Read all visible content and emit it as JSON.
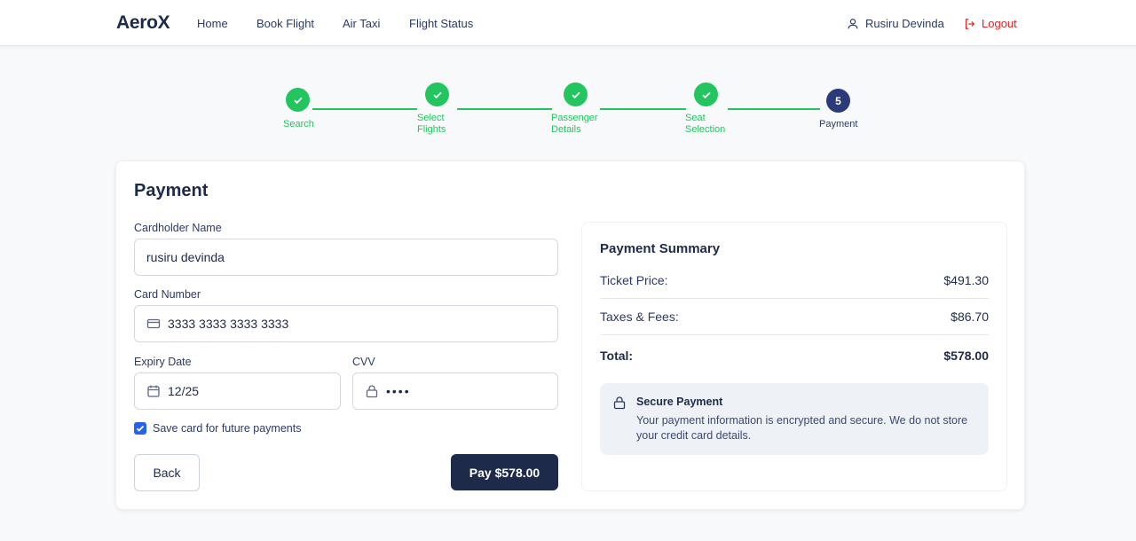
{
  "header": {
    "brand": "AeroX",
    "nav": [
      "Home",
      "Book Flight",
      "Air Taxi",
      "Flight Status"
    ],
    "user_name": "Rusiru Devinda",
    "logout_label": "Logout"
  },
  "stepper": {
    "steps": [
      {
        "label": "Search",
        "status": "complete"
      },
      {
        "label": "Select Flights",
        "status": "complete"
      },
      {
        "label": "Passenger Details",
        "status": "complete"
      },
      {
        "label": "Seat Selection",
        "status": "complete"
      },
      {
        "label": "Payment",
        "status": "active",
        "number": "5"
      }
    ]
  },
  "form": {
    "title": "Payment",
    "cardholder_label": "Cardholder Name",
    "cardholder_value": "rusiru devinda",
    "card_number_label": "Card Number",
    "card_number_value": "3333 3333 3333 3333",
    "expiry_label": "Expiry Date",
    "expiry_value": "12/25",
    "cvv_label": "CVV",
    "cvv_value": "••••",
    "save_card_label": "Save card for future payments",
    "save_card_checked": true,
    "back_label": "Back",
    "pay_label": "Pay $578.00"
  },
  "summary": {
    "title": "Payment Summary",
    "rows": [
      {
        "label": "Ticket Price:",
        "value": "$491.30"
      },
      {
        "label": "Taxes & Fees:",
        "value": "$86.70"
      }
    ],
    "total_label": "Total:",
    "total_value": "$578.00",
    "secure_title": "Secure Payment",
    "secure_text": "Your payment information is encrypted and secure. We do not store your credit card details."
  },
  "colors": {
    "primary": "#1e2a4a",
    "success": "#22c55e",
    "danger": "#dc2626",
    "active_step": "#2b3a7a"
  }
}
